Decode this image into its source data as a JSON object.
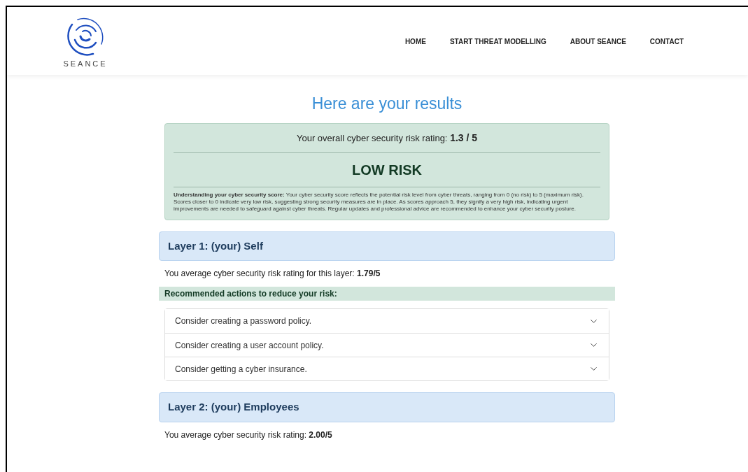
{
  "header": {
    "logo_text": "SEANCE",
    "nav": [
      "HOME",
      "START THREAT MODELLING",
      "ABOUT SEANCE",
      "CONTACT"
    ]
  },
  "title": "Here are your results",
  "summary": {
    "rating_label": "Your overall cyber security risk rating:",
    "rating_value": "1.3 / 5",
    "risk_level": "LOW RISK",
    "explanation": "**Understanding your cyber security score:** Your cyber security score reflects the potential risk level from cyber threats, ranging from 0 (no risk) to 5 (maximum risk). Scores closer to 0 indicate very low risk, suggesting strong security measures are in place. As scores approach 5, they signify a very high risk, indicating urgent improvements are needed to safeguard against cyber threats. Regular updates and professional advice are recommended to enhance your cyber security posture."
  },
  "layers": [
    {
      "title": "Layer 1: (your) Self",
      "rating_label": "You average cyber security risk rating for this layer:",
      "rating_value": "1.79/5",
      "actions_heading": "Recommended actions to reduce your risk:",
      "actions": [
        {
          "label": "Consider creating a password policy.",
          "expanded": false
        },
        {
          "label": "Consider creating a user account policy.",
          "expanded": false
        },
        {
          "label": "Consider getting a cyber insurance.",
          "expanded": false
        }
      ]
    },
    {
      "title": "Layer 2: (your) Employees",
      "rating_label": "You average cyber security risk rating:",
      "rating_value": "2.00/5"
    }
  ]
}
